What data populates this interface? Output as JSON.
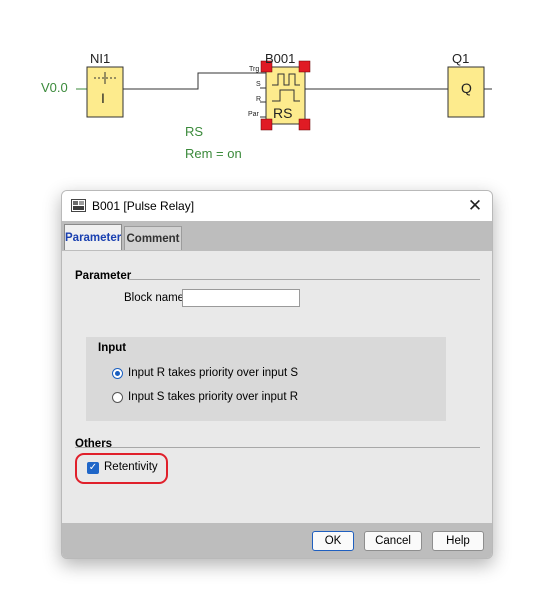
{
  "diagram": {
    "input_label": "V0.0",
    "ni_block": {
      "name": "NI1",
      "symbol": "I"
    },
    "function_block": {
      "name": "B001",
      "pins": [
        "Trg",
        "S",
        "R",
        "Par"
      ],
      "symbol": "RS",
      "info_line1": "RS",
      "info_line2": "Rem = on"
    },
    "output_block": {
      "name": "Q1",
      "symbol": "Q"
    },
    "colors": {
      "selection_handle": "#e01b24",
      "block_fill": "#fdeb8d",
      "input_text": "#3b8a3b"
    }
  },
  "dialog": {
    "title": "B001 [Pulse Relay]",
    "icon": "logo-app-icon",
    "close_glyph": "✕",
    "tabs": [
      {
        "label": "Parameter",
        "active": true
      },
      {
        "label": "Comment",
        "active": false
      }
    ],
    "parameter": {
      "group_title": "Parameter",
      "block_name_label": "Block name:",
      "block_name_value": ""
    },
    "input_group": {
      "title": "Input",
      "options": [
        {
          "label": "Input R takes priority over input S",
          "selected": true
        },
        {
          "label": "Input S takes priority over input R",
          "selected": false
        }
      ]
    },
    "others": {
      "title": "Others",
      "retentivity_label": "Retentivity",
      "retentivity_checked": true
    },
    "buttons": {
      "ok": "OK",
      "cancel": "Cancel",
      "help": "Help"
    },
    "colors": {
      "accent": "#1f66c8",
      "highlight": "#e0202b"
    }
  }
}
